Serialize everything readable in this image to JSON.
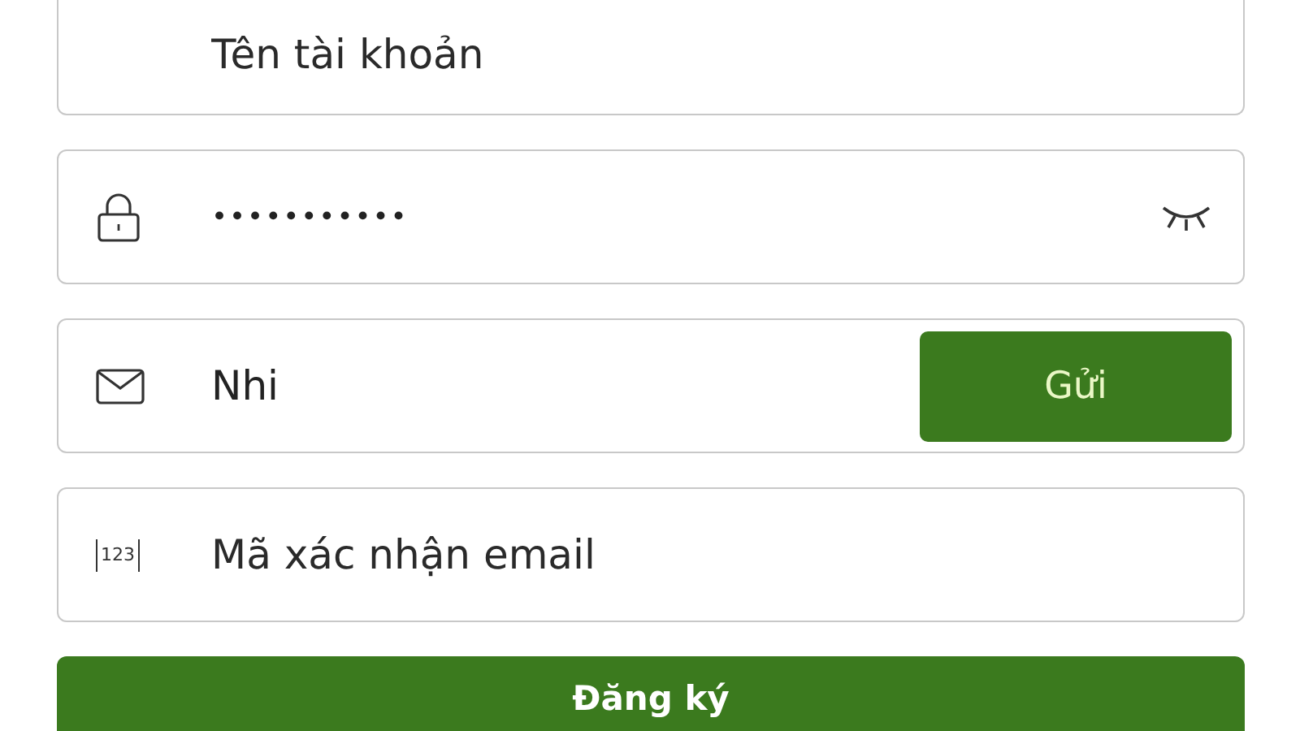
{
  "fields": [
    {
      "kind": "username",
      "placeholder": "Tên tài khoản"
    },
    {
      "kind": "password",
      "value": "•••••••••••",
      "revealed": false
    },
    {
      "kind": "email",
      "value": "Nhi",
      "button": "Gửi"
    },
    {
      "kind": "code",
      "icon_text": "123",
      "placeholder": "Mã xác nhận email"
    }
  ],
  "submit": {
    "label": "Đăng ký"
  }
}
